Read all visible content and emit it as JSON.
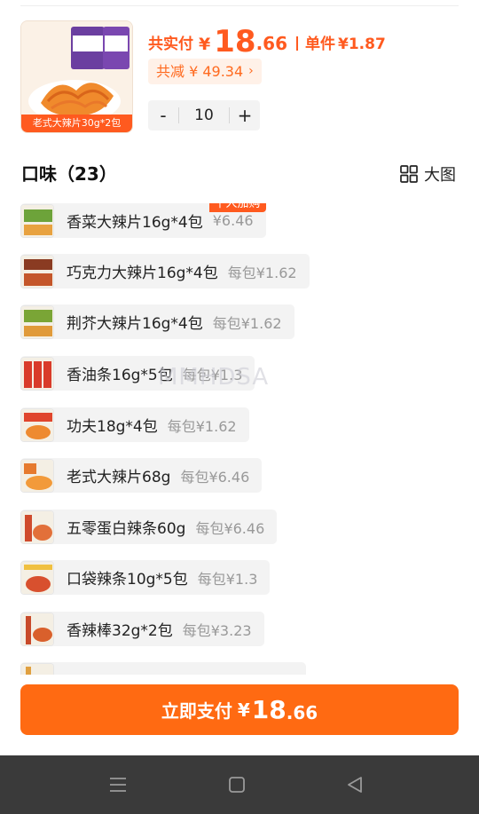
{
  "product": {
    "thumb_caption": "老式大辣片30g*2包",
    "thumb_brand_text": "大辣片"
  },
  "price": {
    "total_label": "共实付",
    "currency": "¥",
    "total_int": "18",
    "total_dec": ".66",
    "unit_label": "单件",
    "unit_price": "¥1.87"
  },
  "discount": {
    "text": "共减 ¥ 49.34",
    "chevron": "›"
  },
  "stepper": {
    "minus": "-",
    "quantity": "10",
    "plus": "+"
  },
  "flavor": {
    "title": "口味（23）",
    "view_toggle_label": "大图",
    "view_toggle_icon": "grid-icon"
  },
  "options": [
    {
      "name": "香菜大辣片16g*4包",
      "price": "¥6.46",
      "badge": "千人加购",
      "thumb_color": "#6da33a"
    },
    {
      "name": "巧克力大辣片16g*4包",
      "price": "每包¥1.62",
      "thumb_color": "#8a3b22"
    },
    {
      "name": "荆芥大辣片16g*4包",
      "price": "每包¥1.62",
      "thumb_color": "#7aa536"
    },
    {
      "name": "香油条16g*5包",
      "price": "每包¥1.3",
      "thumb_color": "#d93b2a"
    },
    {
      "name": "功夫18g*4包",
      "price": "每包¥1.62",
      "thumb_color": "#e0452c"
    },
    {
      "name": "老式大辣片68g",
      "price": "每包¥6.46",
      "thumb_color": "#e67a2e"
    },
    {
      "name": "五零蛋白辣条60g",
      "price": "每包¥6.46",
      "thumb_color": "#cf4b2d"
    },
    {
      "name": "口袋辣条10g*5包",
      "price": "每包¥1.3",
      "thumb_color": "#d8502e"
    },
    {
      "name": "香辣棒32g*2包",
      "price": "每包¥3.23",
      "thumb_color": "#c84a2a"
    },
    {
      "name": "",
      "price": "",
      "thumb_color": "#e0a040"
    }
  ],
  "watermark": "MMHDSA",
  "pay_button": {
    "label": "立即支付",
    "currency": "¥",
    "int": "18",
    "dec": ".66"
  },
  "navbar": {
    "menu_icon": "menu-icon",
    "home_icon": "home-square-icon",
    "back_icon": "back-triangle-icon"
  },
  "colors": {
    "accent": "#ff5a1f",
    "pay_button": "#ff6a12",
    "navbar": "#3a3a3a",
    "option_bg": "#f3f3f3"
  }
}
